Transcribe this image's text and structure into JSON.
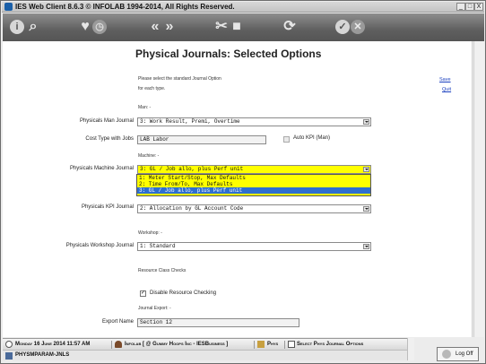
{
  "window": {
    "title": "IES Web Client 8.6.3 © INFOLAB 1994-2014, All Rights Reserved.",
    "min_label": "_",
    "max_label": "□",
    "close_label": "X"
  },
  "page": {
    "heading": "Physical Journals: Selected Options",
    "instruction_line1": "Please select the standard Journal Option",
    "instruction_line2": "for each type.",
    "save_link": "Save",
    "quit_link": "Quit"
  },
  "form": {
    "man_section": "Man: -",
    "man_journal_label": "Physicals Man Journal",
    "man_journal_value": "3: Work Result, Premi, Overtime",
    "cost_type_label": "Cost Type with Jobs",
    "cost_type_value": "LAB Labor",
    "auto_kpi_label": "Auto KPI (Man)",
    "machine_section": "Machine: -",
    "machine_journal_label": "Physicals Machine Journal",
    "machine_journal_value": "3: GL / Job allo, plus Perf unit",
    "machine_options": [
      "1: Meter Start/Stop, Max Defaults",
      "2: Time From/To, Max Defaults",
      "3: GL / Job allo, plus Perf unit"
    ],
    "kpi_journal_label": "Physicals KPI Journal",
    "kpi_journal_value": "2: Allocation by GL Account Code",
    "workshop_section": "Workshop: -",
    "workshop_journal_label": "Physicals Workshop Journal",
    "workshop_journal_value": "1: Standard",
    "resource_class_section": "Resource Class Checks",
    "disable_resource_label": "Disable Resource Checking",
    "disable_resource_checked": "✓",
    "journal_export_section": "Journal Export: -",
    "export_name_label": "Export Name",
    "export_name_value": "Section 12"
  },
  "status": {
    "date": "Monday 16 June 2014 11:57 AM",
    "company": "Infolab [ @ Gummy Hoops Inc - IESBusiness ]",
    "module": "Phys",
    "screen": "Select Phys Journal Options",
    "program": "PHYSMPARAM-JNLS",
    "logoff_label": "Log Off"
  },
  "colors": {
    "highlight": "#ffff00",
    "selection": "#2f6fd0",
    "link": "#1a3fbf"
  },
  "toolbar_icons": [
    "info-icon",
    "search-icon",
    "favorite-icon",
    "history-icon",
    "previous-icon",
    "next-icon",
    "tools-icon",
    "stop-icon",
    "refresh-icon",
    "ok-icon",
    "cancel-icon"
  ]
}
